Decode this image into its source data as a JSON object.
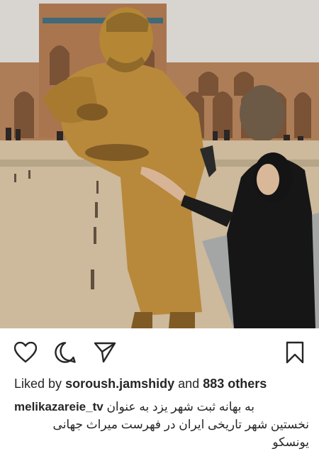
{
  "post": {
    "liked_by_prefix": "Liked by",
    "liked_by_user": "soroush.jamshidy",
    "and_text": "and",
    "others_count": "883 others"
  },
  "caption": {
    "username": "melikazareie_tv",
    "line1": "به بهانه ثبت شهر یزد به عنوان",
    "line2": "نخستین شهر تاریخی ایران در فهرست میراث جهانی",
    "line3": "یونسکو"
  },
  "actions": {
    "like_icon": "heart-icon",
    "comment_icon": "comment-icon",
    "share_icon": "share-icon",
    "save_icon": "bookmark-icon"
  },
  "colors": {
    "text": "#262626",
    "statue_gold": "#b88a3a",
    "sky": "#d6d3cf",
    "ground": "#c9b79a",
    "building": "#a97a55"
  }
}
